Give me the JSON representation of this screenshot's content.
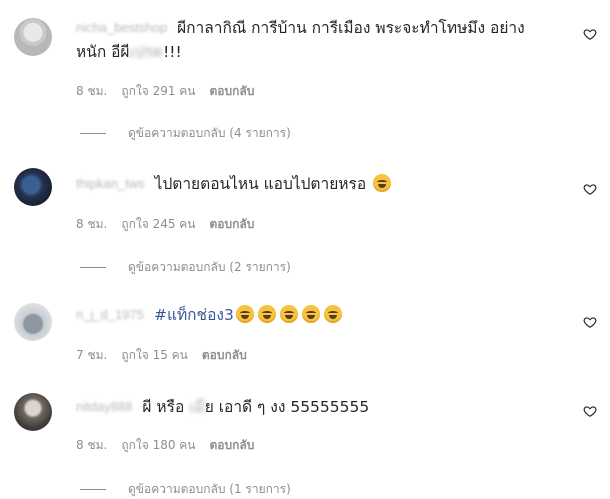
{
  "comments": [
    {
      "username": "nicha_bestshop",
      "text_before": "ผีกาลากิณี การีบ้าน การีเมือง พระจะทำโทษมึง อย่างหนัก อีผี",
      "text_blur": "เปรต",
      "text_after": "!!!",
      "time": "8 ชม.",
      "likes": "ถูกใจ 291 คน",
      "reply": "ตอบกลับ",
      "view_replies": "ดูข้อความตอบกลับ (4 รายการ)"
    },
    {
      "username": "thipkan_tws",
      "text": "ไปตายตอนไหน แอบไปตายหรอ",
      "emoji": "face-with-tears-of-joy",
      "time": "8 ชม.",
      "likes": "ถูกใจ 245 คน",
      "reply": "ตอบกลับ",
      "view_replies": "ดูข้อความตอบกลับ (2 รายการ)"
    },
    {
      "username": "n_j_d_1975",
      "hashtag": "#แท็กช่อง3",
      "emoji": "grinning-squinting-face",
      "emoji_count": 5,
      "time": "7 ชม.",
      "likes": "ถูกใจ 15 คน",
      "reply": "ตอบกลับ"
    },
    {
      "username": "nitday888",
      "text_before": "ผี หรือ ",
      "text_blur": "เมี",
      "text_after": "ย เอาดี ๆ งง 55555555",
      "time": "8 ชม.",
      "likes": "ถูกใจ 180 คน",
      "reply": "ตอบกลับ",
      "view_replies": "ดูข้อความตอบกลับ (1 รายการ)"
    }
  ],
  "icons": {
    "like": "heart-outline-icon"
  },
  "colors": {
    "text": "#262626",
    "secondary": "#8e8e8e",
    "hashtag": "#385898"
  }
}
